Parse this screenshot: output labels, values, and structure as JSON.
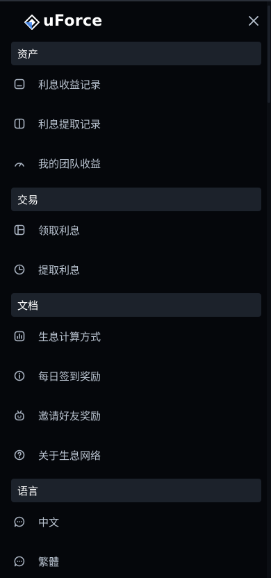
{
  "brand": {
    "name": "uForce",
    "logo_icon": "diamond-logo-icon"
  },
  "header": {
    "close_icon": "close-icon"
  },
  "colors": {
    "background": "#05070b",
    "section_bg": "#1c222b",
    "item_text": "#b8c2cf",
    "icon": "#a9b3c1"
  },
  "menu": {
    "sections": [
      {
        "title": "资产",
        "items": [
          {
            "label": "利息收益记录",
            "icon": "wallet-icon"
          },
          {
            "label": "利息提取记录",
            "icon": "columns-icon"
          },
          {
            "label": "我的团队收益",
            "icon": "gauge-icon"
          }
        ]
      },
      {
        "title": "交易",
        "items": [
          {
            "label": "领取利息",
            "icon": "layout-icon"
          },
          {
            "label": "提取利息",
            "icon": "pie-chart-icon"
          }
        ]
      },
      {
        "title": "文档",
        "items": [
          {
            "label": "生息计算方式",
            "icon": "bar-chart-icon"
          },
          {
            "label": "每日签到奖励",
            "icon": "info-icon"
          },
          {
            "label": "邀请好友奖励",
            "icon": "robot-icon"
          },
          {
            "label": "关于生息网络",
            "icon": "help-icon"
          }
        ]
      },
      {
        "title": "语言",
        "items": [
          {
            "label": "中文",
            "icon": "chat-icon"
          },
          {
            "label": "繁體",
            "icon": "chat-icon"
          }
        ]
      }
    ]
  }
}
